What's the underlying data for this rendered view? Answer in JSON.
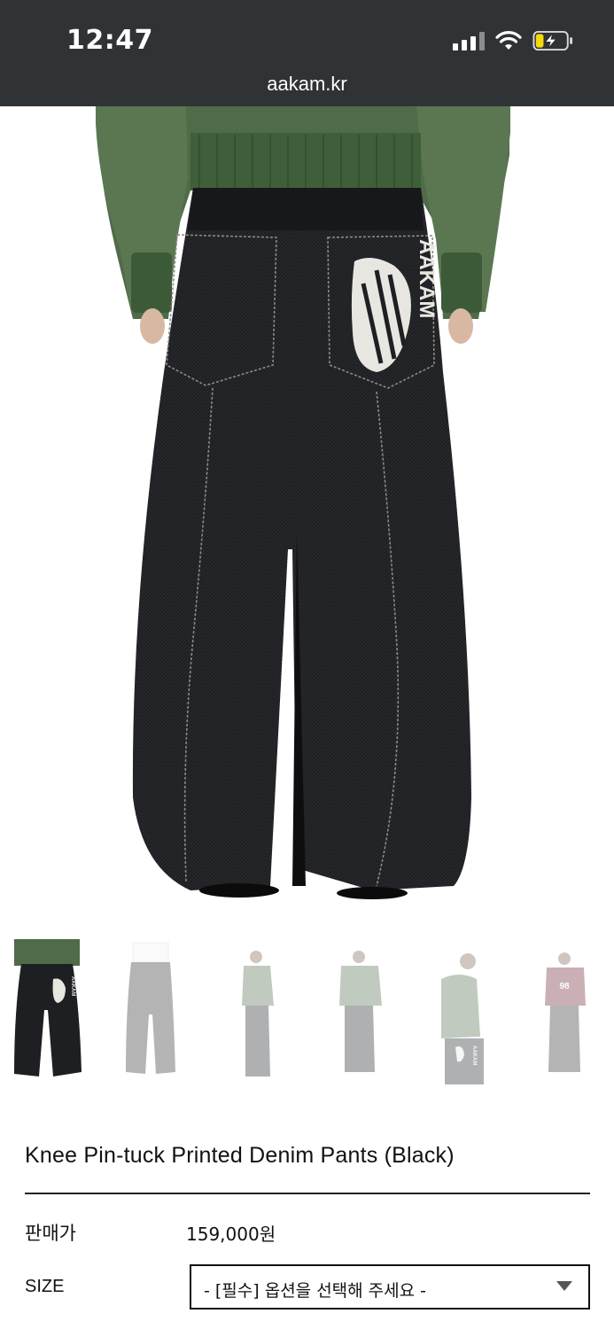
{
  "status_bar": {
    "time": "12:47",
    "icons": [
      "cellular-signal-icon",
      "wifi-icon",
      "battery-charging-icon"
    ],
    "battery_level": 0.25,
    "battery_color": "#f5d90a"
  },
  "browser": {
    "url": "aakam.kr"
  },
  "hero_image": {
    "pocket_print_text": "AAKAM"
  },
  "thumbnails": {
    "count": 6,
    "selected_index": 0,
    "items": [
      {
        "pocket_print_text": "AAKAM"
      },
      {},
      {},
      {},
      {
        "pocket_print_text": "AAKAM"
      },
      {
        "shirt_print_text": "98"
      }
    ]
  },
  "product": {
    "title": "Knee Pin-tuck Printed Denim Pants (Black)",
    "price_label": "판매가",
    "price_value": "159,000원",
    "size_label": "SIZE",
    "size_select_value": "- [필수] 옵션을 선택해 주세요 -"
  }
}
